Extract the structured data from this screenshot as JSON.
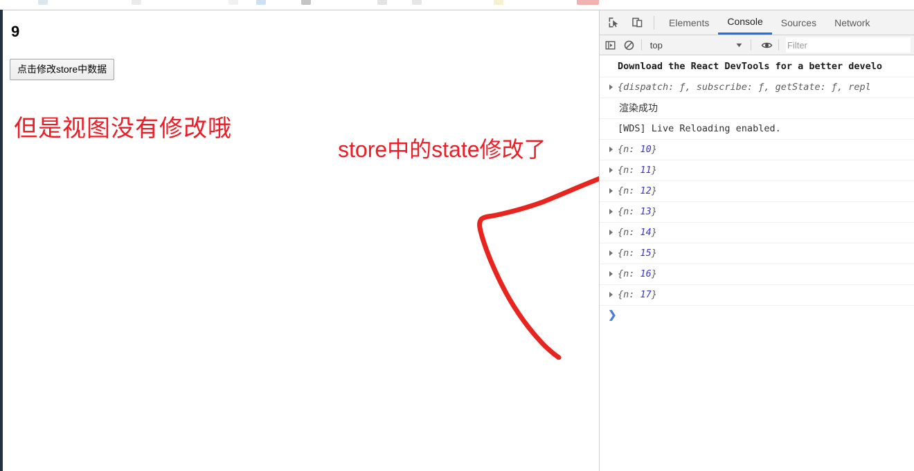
{
  "window": {
    "bookmark_icon_colors": [
      "#9bb7d4",
      "#c7c7c7",
      "#d8d8d8",
      "#6fa8dc",
      "#444444",
      "#b0b0b0",
      "#b8b8b8",
      "#e8d37a",
      "#d42020"
    ]
  },
  "page": {
    "counter_value": "9",
    "modify_button_label": "点击修改store中数据",
    "annotations": {
      "view_not_updated": "但是视图没有修改哦",
      "store_state_changed": "store中的state修改了",
      "color": "#ee1c25"
    }
  },
  "devtools": {
    "icons": {
      "inspect": "inspect-element-icon",
      "device": "device-toolbar-icon",
      "sidebar": "console-sidebar-icon",
      "clear": "clear-console-icon",
      "eye": "console-settings-eye-icon"
    },
    "tabs": [
      {
        "label": "Elements",
        "active": false
      },
      {
        "label": "Console",
        "active": true
      },
      {
        "label": "Sources",
        "active": false
      },
      {
        "label": "Network",
        "active": false
      }
    ],
    "active_tab_color": "#1a73e8",
    "filter_bar": {
      "context": "top",
      "caret": "▼",
      "filter_placeholder": "Filter",
      "filter_value": ""
    },
    "console_rows": [
      {
        "kind": "bold",
        "text": "Download the React DevTools for a better develo",
        "expandable": false
      },
      {
        "kind": "object",
        "text": "{dispatch: ƒ, subscribe: ƒ, getState: ƒ, repl",
        "expandable": true
      },
      {
        "kind": "plain",
        "text": "渲染成功",
        "expandable": false
      },
      {
        "kind": "mono",
        "text": "[WDS] Live Reloading enabled.",
        "expandable": false
      },
      {
        "kind": "object-n",
        "prefix": "{n: ",
        "value": "10",
        "suffix": "}",
        "expandable": true
      },
      {
        "kind": "object-n",
        "prefix": "{n: ",
        "value": "11",
        "suffix": "}",
        "expandable": true
      },
      {
        "kind": "object-n",
        "prefix": "{n: ",
        "value": "12",
        "suffix": "}",
        "expandable": true
      },
      {
        "kind": "object-n",
        "prefix": "{n: ",
        "value": "13",
        "suffix": "}",
        "expandable": true
      },
      {
        "kind": "object-n",
        "prefix": "{n: ",
        "value": "14",
        "suffix": "}",
        "expandable": true
      },
      {
        "kind": "object-n",
        "prefix": "{n: ",
        "value": "15",
        "suffix": "}",
        "expandable": true
      },
      {
        "kind": "object-n",
        "prefix": "{n: ",
        "value": "16",
        "suffix": "}",
        "expandable": true
      },
      {
        "kind": "object-n",
        "prefix": "{n: ",
        "value": "17",
        "suffix": "}",
        "expandable": true
      }
    ],
    "prompt_caret": "❯"
  }
}
